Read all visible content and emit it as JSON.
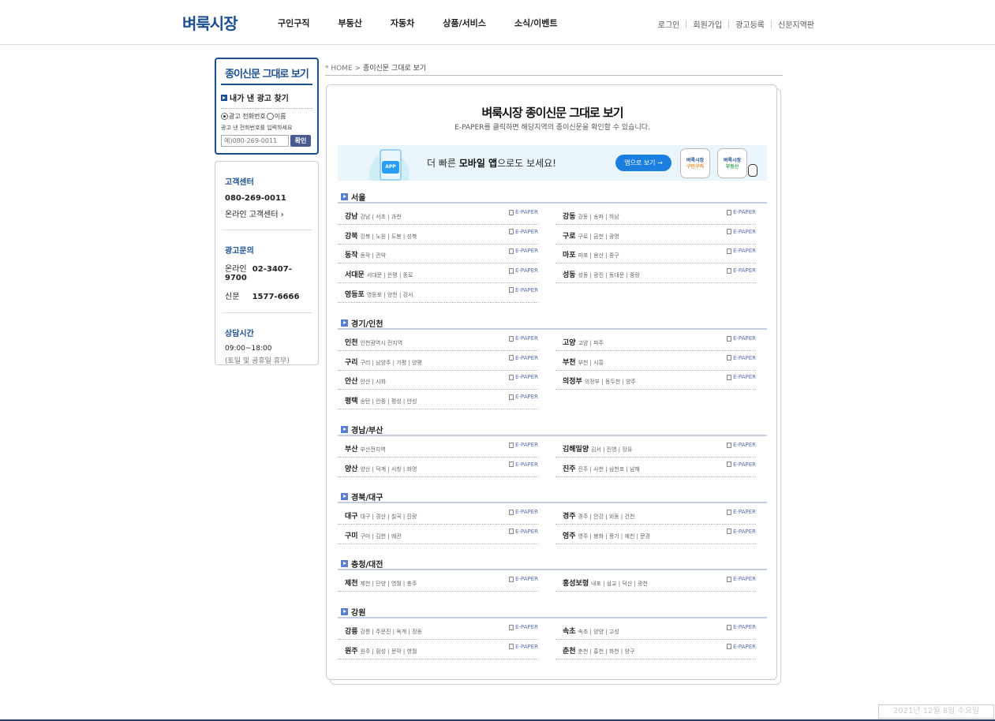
{
  "header": {
    "logo": "벼룩시장",
    "nav": [
      "구인구직",
      "부동산",
      "자동차",
      "상품/서비스",
      "소식/이벤트"
    ],
    "util": [
      "로그인",
      "회원가입",
      "광고등록",
      "신문지역판"
    ]
  },
  "sidebar": {
    "paper_title": "종이신문 그대로 보기",
    "find_title": "내가 낸 광고 찾기",
    "radio_phone": "광고 전화번호",
    "radio_name": "이름",
    "hint": "광고 낸 전화번호를 입력하세요",
    "input_placeholder": "예)080-269-0011",
    "confirm": "확인",
    "cs_title": "고객센터",
    "cs_phone": "080-269-0011",
    "cs_online": "온라인 고객센터",
    "ad_title": "광고문의",
    "ad_online_label": "온라인",
    "ad_online_num": "02-3407-9700",
    "ad_paper_label": "신문",
    "ad_paper_num": "1577-6666",
    "hours_title": "상담시간",
    "hours": "09:00~18:00",
    "hours_note": "(토일 및 공휴일 휴무)"
  },
  "breadcrumb": {
    "home": "* HOME",
    "current": "종이신문 그대로 보기"
  },
  "main": {
    "title": "벼룩시장 종이신문 그대로 보기",
    "subtitle": "E-PAPER를 클릭하면 해당지역의 종이신문을 확인할 수 있습니다.",
    "banner": {
      "app_label": "APP",
      "text_pre": "더 빠른 ",
      "text_bold": "모바일 앱",
      "text_post": "으로도 보세요!",
      "button": "앱으로 보기 →",
      "icon1_l1": "벼룩시장",
      "icon1_l2": "구인구직",
      "icon2_l1": "벼룩시장",
      "icon2_l2": "부동산"
    },
    "epaper_label": "E-PAPER",
    "regions": [
      {
        "name": "서울",
        "items": [
          {
            "name": "강남",
            "sub": "강남 | 서초 | 과천"
          },
          {
            "name": "강동",
            "sub": "강동 | 송파 | 하남"
          },
          {
            "name": "강북",
            "sub": "강북 | 노원 | 도봉 | 성북"
          },
          {
            "name": "구로",
            "sub": "구로 | 금천 | 광명"
          },
          {
            "name": "동작",
            "sub": "동작 | 관악"
          },
          {
            "name": "마포",
            "sub": "마포 | 용산 | 중구"
          },
          {
            "name": "서대문",
            "sub": "서대문 | 은평 | 종로"
          },
          {
            "name": "성동",
            "sub": "성동 | 광진 | 동대문 | 중랑"
          },
          {
            "name": "영등포",
            "sub": "영등포 | 양천 | 강서"
          }
        ]
      },
      {
        "name": "경기/인천",
        "items": [
          {
            "name": "인천",
            "sub": "인천광역시 전지역"
          },
          {
            "name": "고양",
            "sub": "고양 | 파주"
          },
          {
            "name": "구리",
            "sub": "구리 | 남양주 | 가평 | 양평"
          },
          {
            "name": "부천",
            "sub": "부천 | 시흥"
          },
          {
            "name": "안산",
            "sub": "안산 | 시화"
          },
          {
            "name": "의정부",
            "sub": "의정부 | 동두천 | 양주"
          },
          {
            "name": "평택",
            "sub": "송탄 | 안중 | 평성 | 안성"
          }
        ]
      },
      {
        "name": "경남/부산",
        "items": [
          {
            "name": "부산",
            "sub": "부산전지역"
          },
          {
            "name": "김해밀양",
            "sub": "김서 | 진영 | 장유"
          },
          {
            "name": "양산",
            "sub": "양산 | 덕계 | 서창 | 화명"
          },
          {
            "name": "진주",
            "sub": "진주 | 사천 | 삼천포 | 남해"
          }
        ]
      },
      {
        "name": "경북/대구",
        "items": [
          {
            "name": "대구",
            "sub": "대구 | 경산 | 칠곡 | 진량"
          },
          {
            "name": "경주",
            "sub": "경주 | 안강 | 외동 | 건천"
          },
          {
            "name": "구미",
            "sub": "구미 | 김천 | 왜관"
          },
          {
            "name": "영주",
            "sub": "영주 | 봉화 | 풍기 | 예천 | 문경"
          }
        ]
      },
      {
        "name": "충청/대전",
        "items": [
          {
            "name": "제천",
            "sub": "제천 | 단양 | 영월 | 충주"
          },
          {
            "name": "홍성보령",
            "sub": "내포 | 삼교 | 덕산 | 광천"
          }
        ]
      },
      {
        "name": "강원",
        "items": [
          {
            "name": "강릉",
            "sub": "강릉 | 주문진 | 옥계 | 정동"
          },
          {
            "name": "속초",
            "sub": "속초 | 양양 | 고성"
          },
          {
            "name": "원주",
            "sub": "원주 | 횡성 | 문막 | 영월"
          },
          {
            "name": "춘천",
            "sub": "춘천 | 홍천 | 화천 | 양구"
          }
        ]
      }
    ]
  },
  "footer_date": "2021년 12월 8일 수요일",
  "colors": {
    "brand": "#1d4f91",
    "epaper": "#5a6fb5",
    "banner_button": "#1a7fe0"
  }
}
